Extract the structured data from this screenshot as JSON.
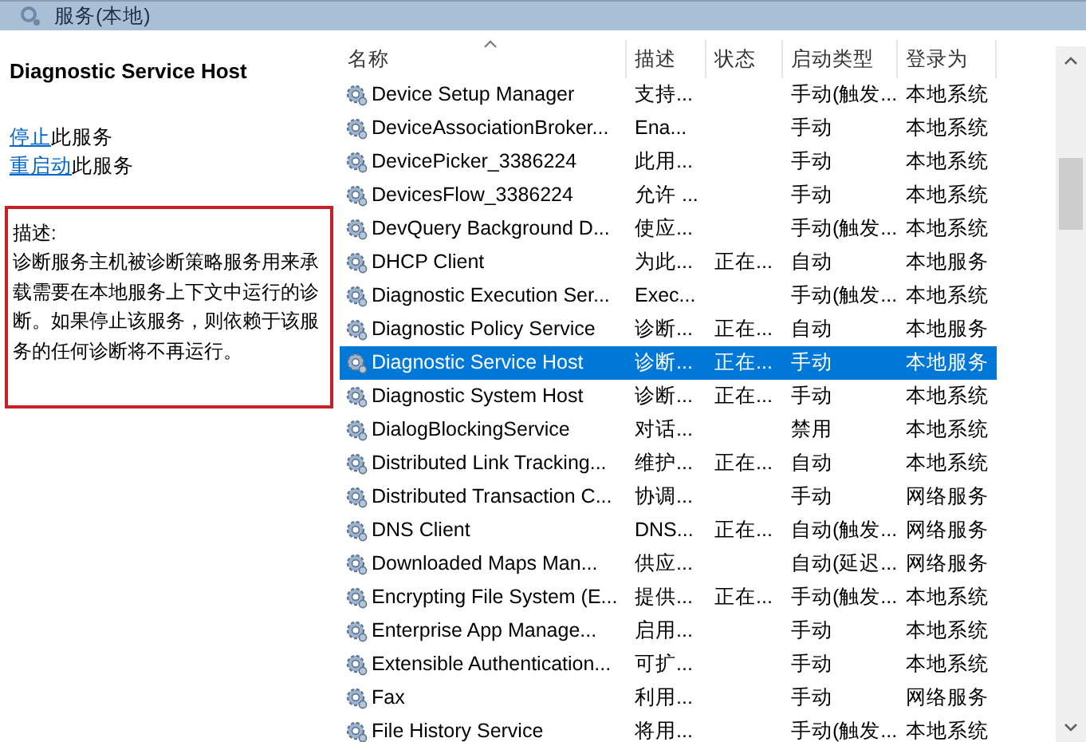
{
  "window": {
    "title": "服务(本地)"
  },
  "detail": {
    "title": "Diagnostic Service Host",
    "actions": [
      {
        "link": "停止",
        "text": "此服务"
      },
      {
        "link": "重启动",
        "text": "此服务"
      }
    ],
    "description_label": "描述:",
    "description": "诊断服务主机被诊断策略服务用来承载需要在本地服务上下文中运行的诊断。如果停止该服务，则依赖于该服务的任何诊断将不再运行。"
  },
  "table": {
    "columns": [
      {
        "label": "名称",
        "sorted": true
      },
      {
        "label": "描述",
        "sorted": false
      },
      {
        "label": "状态",
        "sorted": false
      },
      {
        "label": "启动类型",
        "sorted": false
      },
      {
        "label": "登录为",
        "sorted": false
      }
    ],
    "rows": [
      {
        "name": "Device Setup Manager",
        "description": "支持...",
        "status": "",
        "startup": "手动(触发...",
        "logon": "本地系统",
        "selected": false
      },
      {
        "name": "DeviceAssociationBroker...",
        "description": "Ena...",
        "status": "",
        "startup": "手动",
        "logon": "本地系统",
        "selected": false
      },
      {
        "name": "DevicePicker_3386224",
        "description": "此用...",
        "status": "",
        "startup": "手动",
        "logon": "本地系统",
        "selected": false
      },
      {
        "name": "DevicesFlow_3386224",
        "description": "允许 ...",
        "status": "",
        "startup": "手动",
        "logon": "本地系统",
        "selected": false
      },
      {
        "name": "DevQuery Background D...",
        "description": "使应...",
        "status": "",
        "startup": "手动(触发...",
        "logon": "本地系统",
        "selected": false
      },
      {
        "name": "DHCP Client",
        "description": "为此...",
        "status": "正在...",
        "startup": "自动",
        "logon": "本地服务",
        "selected": false
      },
      {
        "name": "Diagnostic Execution Ser...",
        "description": "Exec...",
        "status": "",
        "startup": "手动(触发...",
        "logon": "本地系统",
        "selected": false
      },
      {
        "name": "Diagnostic Policy Service",
        "description": "诊断...",
        "status": "正在...",
        "startup": "自动",
        "logon": "本地服务",
        "selected": false
      },
      {
        "name": "Diagnostic Service Host",
        "description": "诊断...",
        "status": "正在...",
        "startup": "手动",
        "logon": "本地服务",
        "selected": true
      },
      {
        "name": "Diagnostic System Host",
        "description": "诊断...",
        "status": "正在...",
        "startup": "手动",
        "logon": "本地系统",
        "selected": false
      },
      {
        "name": "DialogBlockingService",
        "description": "对话...",
        "status": "",
        "startup": "禁用",
        "logon": "本地系统",
        "selected": false
      },
      {
        "name": "Distributed Link Tracking...",
        "description": "维护...",
        "status": "正在...",
        "startup": "自动",
        "logon": "本地系统",
        "selected": false
      },
      {
        "name": "Distributed Transaction C...",
        "description": "协调...",
        "status": "",
        "startup": "手动",
        "logon": "网络服务",
        "selected": false
      },
      {
        "name": "DNS Client",
        "description": "DNS...",
        "status": "正在...",
        "startup": "自动(触发...",
        "logon": "网络服务",
        "selected": false
      },
      {
        "name": "Downloaded Maps Man...",
        "description": "供应...",
        "status": "",
        "startup": "自动(延迟...",
        "logon": "网络服务",
        "selected": false
      },
      {
        "name": "Encrypting File System (E...",
        "description": "提供...",
        "status": "正在...",
        "startup": "手动(触发...",
        "logon": "本地系统",
        "selected": false
      },
      {
        "name": "Enterprise App Manage...",
        "description": "启用...",
        "status": "",
        "startup": "手动",
        "logon": "本地系统",
        "selected": false
      },
      {
        "name": "Extensible Authentication...",
        "description": "可扩...",
        "status": "",
        "startup": "手动",
        "logon": "本地系统",
        "selected": false
      },
      {
        "name": "Fax",
        "description": "利用...",
        "status": "",
        "startup": "手动",
        "logon": "网络服务",
        "selected": false
      },
      {
        "name": "File History Service",
        "description": "将用...",
        "status": "",
        "startup": "手动(触发...",
        "logon": "本地系统",
        "selected": false
      }
    ]
  }
}
